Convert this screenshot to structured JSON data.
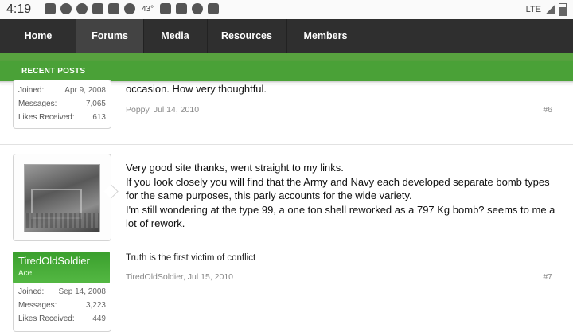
{
  "status_bar": {
    "time": "4:19",
    "temperature": "43°",
    "network": "LTE",
    "icons": [
      "app-icon",
      "pinterest-icon",
      "messenger-icon",
      "gmail-icon",
      "gallery-icon",
      "navigation-icon",
      "game-icon",
      "youtube-icon",
      "cloud-icon",
      "photo-icon"
    ]
  },
  "nav": {
    "tabs": [
      {
        "label": "Home",
        "active": false
      },
      {
        "label": "Forums",
        "active": true
      },
      {
        "label": "Media",
        "active": false
      },
      {
        "label": "Resources",
        "active": false
      },
      {
        "label": "Members",
        "active": false
      }
    ],
    "sub_label": "RECENT POSTS"
  },
  "posts": [
    {
      "stats": [
        {
          "key": "Joined:",
          "value": "Apr 9, 2008"
        },
        {
          "key": "Messages:",
          "value": "7,065"
        },
        {
          "key": "Likes Received:",
          "value": "613"
        }
      ],
      "text": "occasion. How very thoughtful.",
      "meta": "Poppy, Jul 14, 2010",
      "number": "#6"
    },
    {
      "username": "TiredOldSoldier",
      "user_title": "Ace",
      "stats": [
        {
          "key": "Joined:",
          "value": "Sep 14, 2008"
        },
        {
          "key": "Messages:",
          "value": "3,223"
        },
        {
          "key": "Likes Received:",
          "value": "449"
        }
      ],
      "text_lines": [
        "Very good site thanks, went straight to my links.",
        "If you look closely you will find that the Army and Navy each developed separate bomb types",
        "for the same purposes, this parly accounts for the wide variety.",
        "I'm still wondering at the type 99, a one ton shell reworked as a 797 Kg bomb? seems to me a",
        "lot of rework."
      ],
      "signature": "Truth is the first victim of conflict",
      "meta": "TiredOldSoldier, Jul 15, 2010",
      "number": "#7"
    }
  ]
}
